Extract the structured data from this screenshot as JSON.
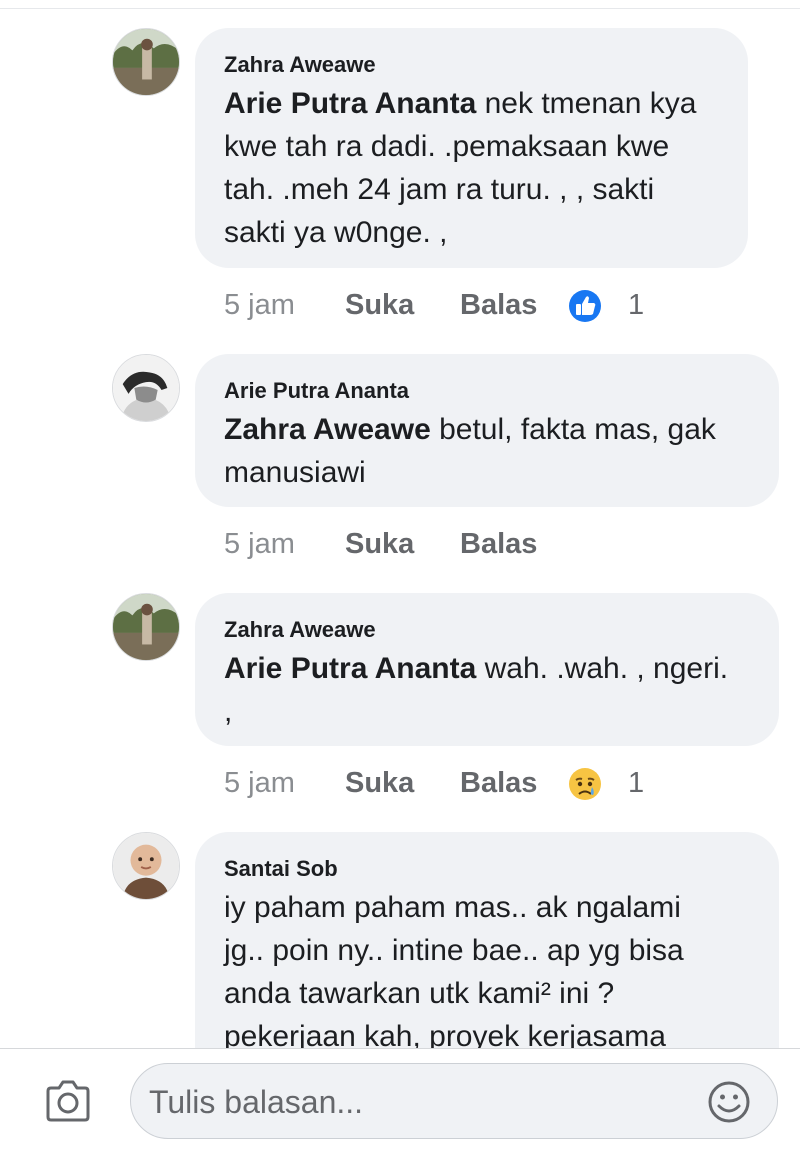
{
  "comments": [
    {
      "author": "Zahra Aweawe",
      "mention": "Arie Putra Ananta",
      "text_lines": [
        " nek tmenan kya",
        "kwe tah ra dadi. .pemaksaan kwe",
        "tah. .meh 24 jam ra turu. , , sakti",
        "sakti ya w0nge. ,"
      ],
      "time": "5 jam",
      "like_label": "Suka",
      "reply_label": "Balas",
      "reaction": "like-reaction-icon",
      "reaction_count": "1"
    },
    {
      "author": "Arie Putra Ananta",
      "mention": "Zahra Aweawe",
      "text_lines": [
        " betul,  fakta mas, gak",
        "manusiawi"
      ],
      "time": "5 jam",
      "like_label": "Suka",
      "reply_label": "Balas"
    },
    {
      "author": "Zahra Aweawe",
      "mention": "Arie Putra Ananta",
      "text_lines": [
        " wah. .wah. , ngeri.",
        ","
      ],
      "time": "5 jam",
      "like_label": "Suka",
      "reply_label": "Balas",
      "reaction": "sad-reaction-icon",
      "reaction_count": "1"
    },
    {
      "author": "Santai Sob",
      "text_lines": [
        "iy paham paham mas.. ak ngalami",
        "jg.. poin ny.. intine bae.. ap yg bisa",
        "anda tawarkan utk kami² ini ?",
        "pekerjaan kah, proyek kerjasama"
      ]
    }
  ],
  "reply_bar": {
    "placeholder": "Tulis balasan...",
    "camera_icon": "camera-icon",
    "emoji_icon": "emoji-icon"
  },
  "colors": {
    "bubble": "#f0f2f5",
    "like_blue": "#1877f2",
    "muted": "#65676b"
  }
}
